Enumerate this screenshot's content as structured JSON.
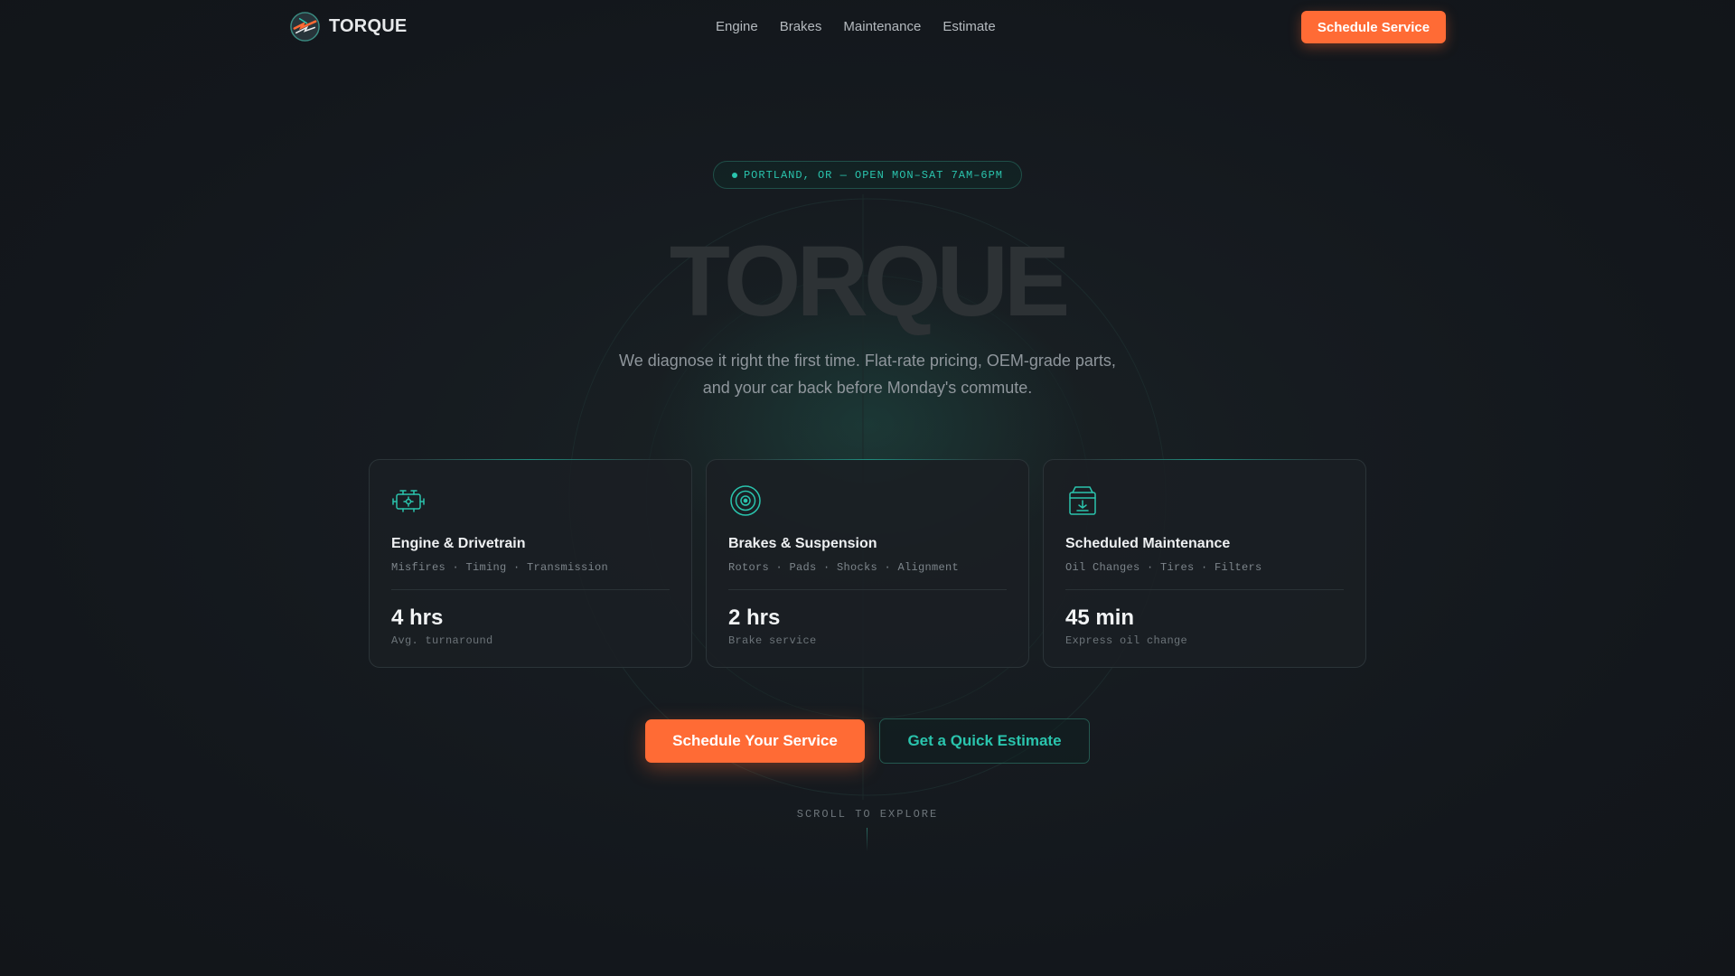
{
  "nav": {
    "brand": "TORQUE",
    "links": [
      "Engine",
      "Brakes",
      "Maintenance",
      "Estimate"
    ],
    "cta": "Schedule Service"
  },
  "hero": {
    "location": "PORTLAND, OR — OPEN MON–SAT 7AM–6PM",
    "title": "TORQUE",
    "subtitle_line1": "We diagnose it right the first time. Flat-rate pricing, OEM-grade parts,",
    "subtitle_line2": "and your car back before Monday's commute."
  },
  "cards": [
    {
      "icon": "engine-icon",
      "title": "Engine & Drivetrain",
      "tags": "Misfires · Timing · Transmission",
      "stat": "4 hrs",
      "stat_label": "Avg. turnaround"
    },
    {
      "icon": "brake-disc-icon",
      "title": "Brakes & Suspension",
      "tags": "Rotors · Pads · Shocks · Alignment",
      "stat": "2 hrs",
      "stat_label": "Brake service"
    },
    {
      "icon": "oil-can-icon",
      "title": "Scheduled Maintenance",
      "tags": "Oil Changes · Tires · Filters",
      "stat": "45 min",
      "stat_label": "Express oil change"
    }
  ],
  "actions": {
    "primary": "Schedule Your Service",
    "secondary": "Get a Quick Estimate"
  },
  "scroll_hint": "SCROLL TO EXPLORE",
  "colors": {
    "accent": "#ff6b35",
    "teal": "#2ac4ad",
    "background": "#13171c"
  }
}
